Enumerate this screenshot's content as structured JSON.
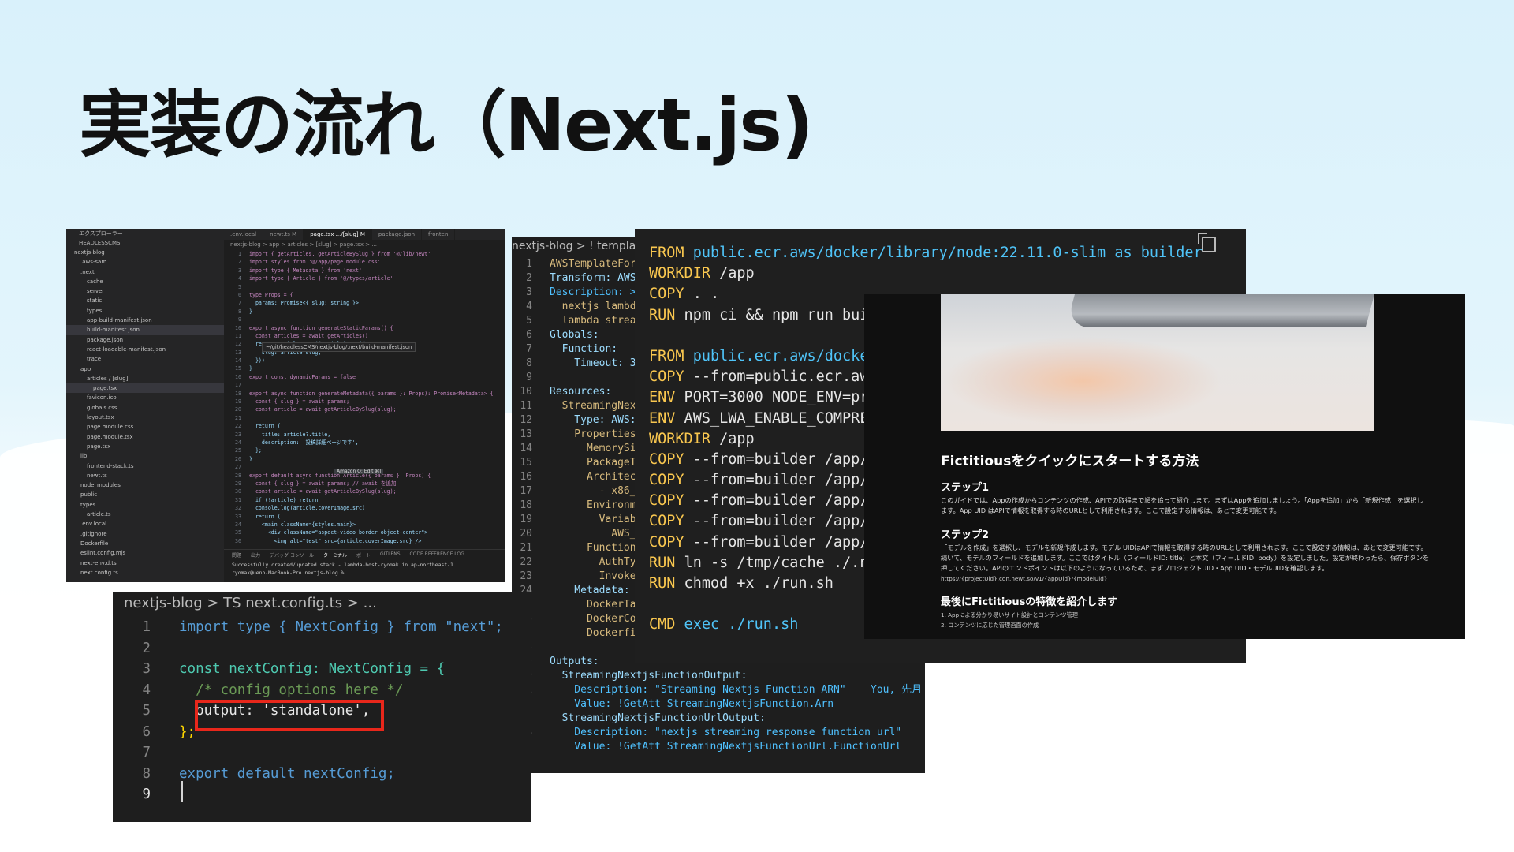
{
  "slide": {
    "title": "実装の流れ（Next.js)"
  },
  "vscode": {
    "explorer_title": "エクスプローラー",
    "root": "HEADLESSCMS",
    "tree": [
      "nextjs-blog",
      ".aws-sam",
      ".next",
      "cache",
      "server",
      "static",
      "types",
      "app-build-manifest.json",
      "build-manifest.json",
      "package.json",
      "react-loadable-manifest.json",
      "trace",
      "app",
      "articles / [slug]",
      "page.tsx",
      "favicon.ico",
      "globals.css",
      "layout.tsx",
      "page.module.css",
      "page.module.tsx",
      "page.tsx",
      "lib",
      "frontend-stack.ts",
      "newt.ts",
      "node_modules",
      "public",
      "types",
      "article.ts",
      ".env.local",
      ".gitignore",
      "Dockerfile",
      "eslint.config.mjs",
      "next-env.d.ts",
      "next.config.ts"
    ],
    "tabs": [
      ".env.local",
      "newt.ts M",
      "page.tsx .../[slug] M",
      "package.json",
      "fronten"
    ],
    "breadcrumb": "nextjs-blog > app > articles > [slug] > page.tsx > ...",
    "tooltip": "~/git/headlessCMS/nextjs-blog/.next/build-manifest.json",
    "amazon_q": "Amazon Q: Edit ⌘I",
    "code": [
      "import { getArticles, getArticleBySlug } from '@/lib/newt'",
      "import styles from '@/app/page.module.css'",
      "import type { Metadata } from 'next'",
      "import type { Article } from '@/types/article'",
      "",
      "type Props = {",
      "  params: Promise<{ slug: string }>",
      "}",
      "",
      "export async function generateStaticParams() {",
      "  const articles = await getArticles()",
      "  return articles.map((article) => ({",
      "    slug: article.slug,",
      "  }))",
      "}",
      "export const dynamicParams = false",
      "",
      "export async function generateMetadata({ params }: Props): Promise<Metadata> {",
      "  const { slug } = await params;",
      "  const article = await getArticleBySlug(slug);",
      "",
      "  return {",
      "    title: article?.title,",
      "    description: '投稿詳細ページです',",
      "  };",
      "}",
      "",
      "export default async function Article({ params }: Props) {",
      "  const { slug } = await params; // await を追加",
      "  const article = await getArticleBySlug(slug);",
      "  if (!article) return",
      "  console.log(article.coverImage.src)",
      "  return (",
      "    <main className={styles.main}>",
      "      <div className=\"aspect-video border object-center\">",
      "        <img alt=\"test\" src={article.coverImage.src} />"
    ],
    "terminal_tabs": [
      "問題",
      "出力",
      "デバッグ コンソール",
      "ターミナル",
      "ポート",
      "GITLENS",
      "CODE REFERENCE LOG"
    ],
    "terminal_lines": [
      "Successfully created/updated stack - lambda-host-ryomak in ap-northeast-1",
      "ryomak@ueno-MacBook-Pro nextjs-blog %"
    ]
  },
  "next_config": {
    "breadcrumb": "nextjs-blog > TS next.config.ts > ...",
    "lines": [
      {
        "n": "1",
        "t": "import type { NextConfig } from \"next\";"
      },
      {
        "n": "2",
        "t": ""
      },
      {
        "n": "3",
        "t": "const nextConfig: NextConfig = {"
      },
      {
        "n": "4",
        "t": "  /* config options here */"
      },
      {
        "n": "5",
        "t": "  output: 'standalone',"
      },
      {
        "n": "6",
        "t": "};"
      },
      {
        "n": "7",
        "t": ""
      },
      {
        "n": "8",
        "t": "export default nextConfig;"
      },
      {
        "n": "9",
        "t": ""
      }
    ]
  },
  "template": {
    "breadcrumb": "nextjs-blog > ! templat",
    "lines": [
      "AWSTemplateForm",
      "Transform: AWS",
      "Description: >",
      "  nextjs lambda",
      "  lambda strea",
      "Globals:",
      "  Function:",
      "    Timeout: 3",
      "",
      "Resources:",
      "  StreamingNext",
      "    Type: AWS:",
      "    Properties",
      "      MemorySi",
      "      PackageTy",
      "      Architec",
      "        - x86_",
      "      Environm",
      "        Variab",
      "          AWS_",
      "      Function",
      "        AuthTy",
      "        Invoke",
      "    Metadata:",
      "      DockerTa",
      "      DockerCo",
      "      Dockerfi",
      "",
      "Outputs:",
      "  StreamingNextjsFunctionOutput:",
      "    Description: \"Streaming Nextjs Function ARN\"    You, 先月 •",
      "    Value: !GetAtt StreamingNextjsFunction.Arn",
      "  StreamingNextjsFunctionUrlOutput:",
      "    Description: \"nextjs streaming response function url\"",
      "    Value: !GetAtt StreamingNextjsFunctionUrl.FunctionUrl"
    ]
  },
  "dockerfile": {
    "lines": [
      "FROM public.ecr.aws/docker/library/node:22.11.0-slim as builder",
      "WORKDIR /app",
      "COPY . .",
      "RUN npm ci && npm run buil",
      "",
      "FROM public.ecr.aws/docker",
      "COPY --from=public.ecr.aws",
      "ENV PORT=3000 NODE_ENV=pro",
      "ENV AWS_LWA_ENABLE_COMPRES",
      "WORKDIR /app",
      "COPY --from=builder /app/p",
      "COPY --from=builder /app/p",
      "COPY --from=builder /app/.",
      "COPY --from=builder /app/.",
      "COPY --from=builder /app/r",
      "RUN ln -s /tmp/cache ./.ne",
      "RUN chmod +x ./run.sh",
      "",
      "CMD exec ./run.sh"
    ]
  },
  "fictitious": {
    "heading": "Fictitiousをクイックにスタートする方法",
    "step1_title": "ステップ1",
    "step1_text": "このガイドでは、Appの作成からコンテンツの作成、APIでの取得まで順を追って紹介します。まずはAppを追加しましょう。「Appを追加」から「新規作成」を選択します。App UID はAPIで情報を取得する時のURLとして利用されます。ここで設定する情報は、あとで変更可能です。",
    "step2_title": "ステップ2",
    "step2_text": "「モデルを作成」を選択し、モデルを新規作成します。モデル UIDはAPIで情報を取得する時のURLとして利用されます。ここで設定する情報は、あとで変更可能です。続いて、モデルのフィールドを追加します。ここではタイトル（フィールドID: title）と本文（フィールドID: body）を設定しました。設定が終わったら、保存ボタンを押してください。APIのエンドポイントは以下のようになっているため、まずプロジェクトUID・App UID・モデルUIDを確認します。",
    "endpoint": "https://{projectUid}.cdn.newt.so/v1/{appUid}/{modelUid}",
    "last_title": "最後にFictitiousの特徴を紹介します",
    "items": [
      "1. Appによる分かり易いサイト設計とコンテンツ管理",
      "2. コンテンツに応じた管理画面の作成"
    ]
  }
}
